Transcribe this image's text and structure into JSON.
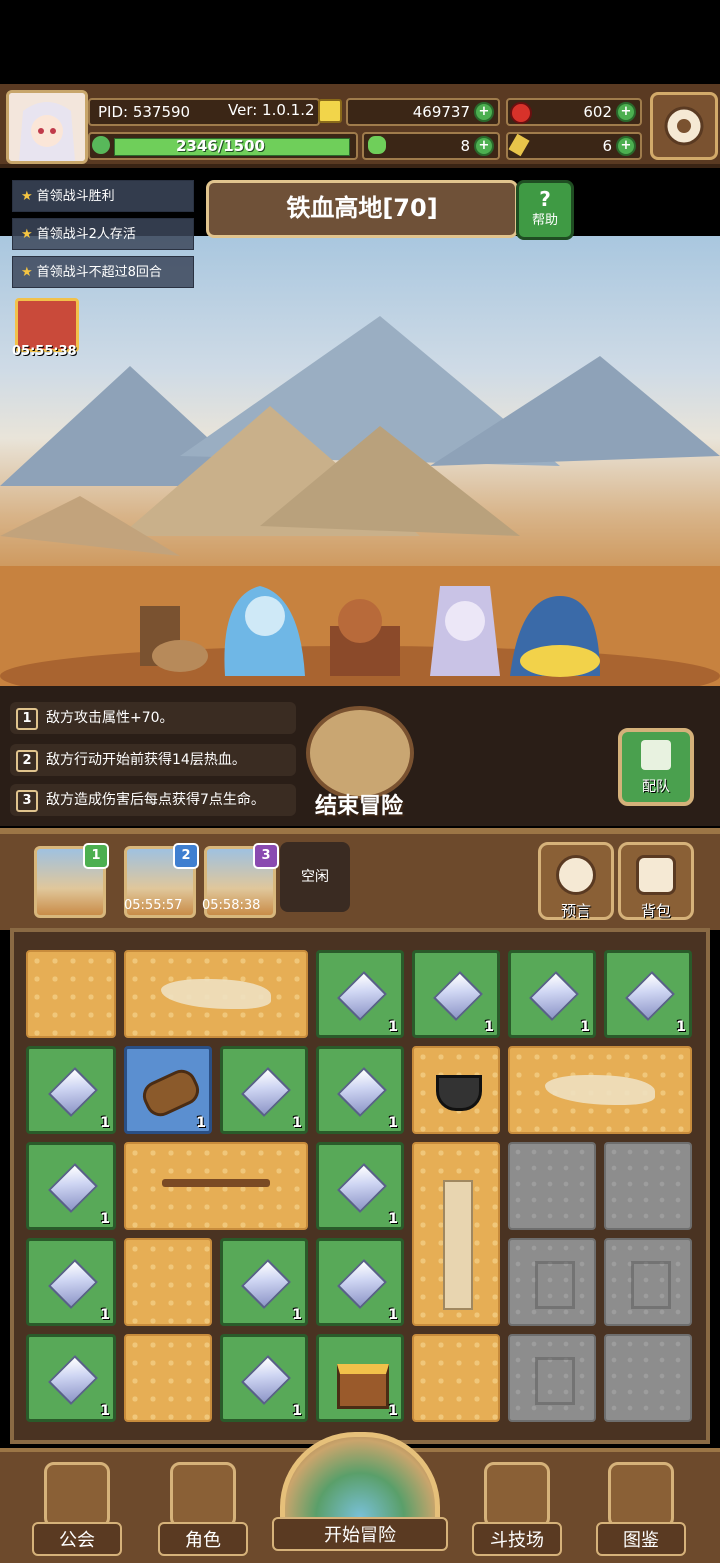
{
  "header": {
    "pid_label": "PID: 537590",
    "version_label": "Ver: 1.0.1.2",
    "gold": "469737",
    "gems": "602",
    "hp_text": "2346/1500",
    "clover": "8",
    "key": "6",
    "hp_fill": 1.0
  },
  "quests": [
    {
      "text": "首领战斗胜利"
    },
    {
      "text": "首领战斗2人存活"
    },
    {
      "text": "首领战斗不超过8回合"
    }
  ],
  "stage": {
    "title": "铁血高地[70]",
    "help_label": "帮助"
  },
  "gift": {
    "timer": "05:55:38"
  },
  "rules": [
    {
      "num": "1",
      "text": "敌方攻击属性+70。"
    },
    {
      "num": "2",
      "text": "敌方行动开始前获得14层热血。"
    },
    {
      "num": "3",
      "text": "敌方造成伤害后每点获得7点生命。"
    }
  ],
  "end_adventure": "结束冒险",
  "team_label": "配队",
  "slots": [
    {
      "badge": "1",
      "timer": ""
    },
    {
      "badge": "2",
      "timer": "05:55:57"
    },
    {
      "badge": "3",
      "timer": "05:58:38"
    }
  ],
  "idle_label": "空闲",
  "forecast_label": "预言",
  "bag_label": "背包",
  "grid": {
    "gem_count": "1",
    "log_count": "1",
    "chest_count": "1"
  },
  "nav": {
    "guild": "公会",
    "character": "角色",
    "start": "开始冒险",
    "arena": "斗技场",
    "codex": "图鉴"
  },
  "colors": {
    "green_tile": "#58a958",
    "sand_tile": "#e6ae55",
    "stone_tile": "#8d8d8d",
    "blue_tile": "#5b8fd0",
    "frame": "#6d4a2c"
  }
}
